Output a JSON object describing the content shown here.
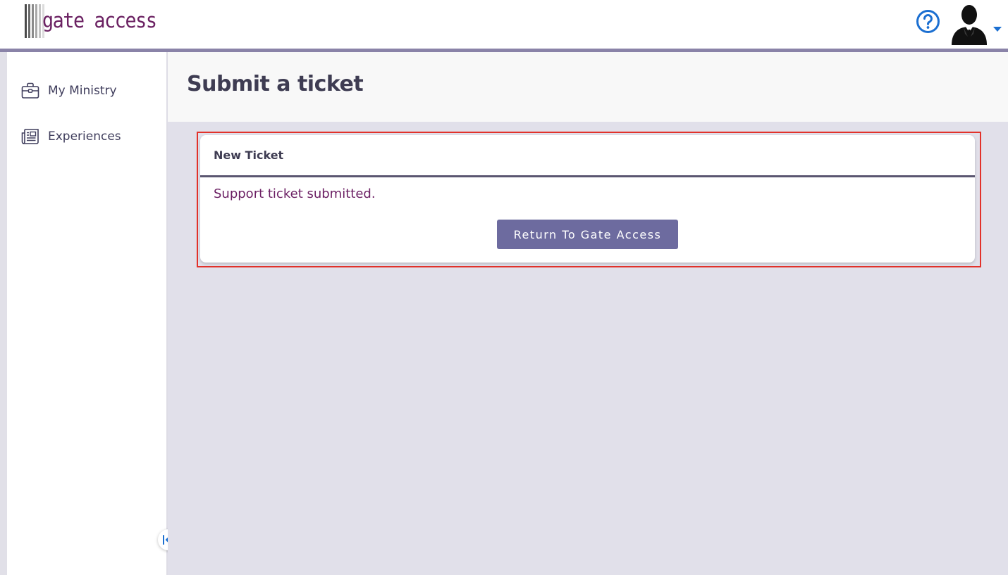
{
  "brand": {
    "name": "gate access",
    "color": "#6b2162"
  },
  "header": {
    "help_icon": "question-circle-icon",
    "avatar_icon": "user-silhouette-icon",
    "dropdown_icon": "caret-down-icon",
    "accent_color": "#1b6fd1"
  },
  "sidebar": {
    "items": [
      {
        "label": "My Ministry",
        "icon": "briefcase-icon"
      },
      {
        "label": "Experiences",
        "icon": "newspaper-icon"
      }
    ],
    "collapse_icon": "collapse-left-icon"
  },
  "page": {
    "title": "Submit a ticket"
  },
  "ticket_card": {
    "title": "New Ticket",
    "message": "Support ticket submitted.",
    "button_label": "Return To Gate Access",
    "highlight_color": "#e2322b"
  }
}
